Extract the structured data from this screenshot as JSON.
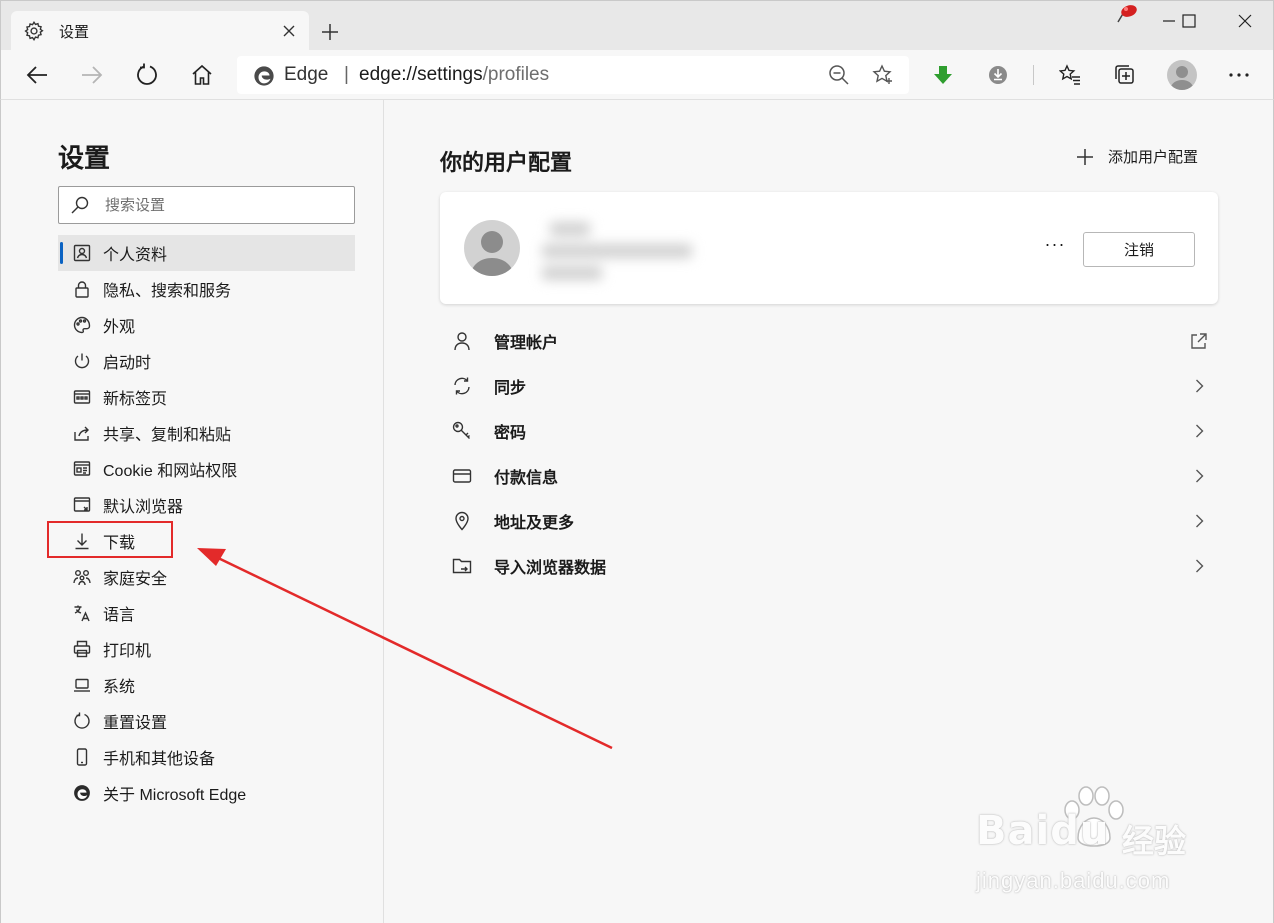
{
  "tab": {
    "title": "设置",
    "icon": "gear-icon"
  },
  "window_controls": [
    "minimize",
    "maximize",
    "close"
  ],
  "toolbar": {
    "back": "back-arrow-icon",
    "forward": "forward-arrow-icon",
    "refresh": "refresh-icon",
    "home": "home-icon",
    "site_label": "Edge",
    "separator": "|",
    "url_main": "edge://settings",
    "url_path": "/profiles"
  },
  "sidebar": {
    "title": "设置",
    "search_placeholder": "搜索设置",
    "items": [
      {
        "label": "个人资料",
        "icon": "profile-icon",
        "active": true
      },
      {
        "label": "隐私、搜索和服务",
        "icon": "lock-icon"
      },
      {
        "label": "外观",
        "icon": "palette-icon"
      },
      {
        "label": "启动时",
        "icon": "power-icon"
      },
      {
        "label": "新标签页",
        "icon": "new-tab-icon"
      },
      {
        "label": "共享、复制和粘贴",
        "icon": "share-icon"
      },
      {
        "label": "Cookie 和网站权限",
        "icon": "site-permissions-icon"
      },
      {
        "label": "默认浏览器",
        "icon": "browser-icon"
      },
      {
        "label": "下载",
        "icon": "download-icon"
      },
      {
        "label": "家庭安全",
        "icon": "family-icon"
      },
      {
        "label": "语言",
        "icon": "language-icon"
      },
      {
        "label": "打印机",
        "icon": "printer-icon"
      },
      {
        "label": "系统",
        "icon": "laptop-icon"
      },
      {
        "label": "重置设置",
        "icon": "reset-icon"
      },
      {
        "label": "手机和其他设备",
        "icon": "phone-icon"
      },
      {
        "label": "关于 Microsoft Edge",
        "icon": "edge-logo-icon"
      }
    ]
  },
  "main": {
    "title": "你的用户配置",
    "add_profile_label": "添加用户配置",
    "profile_card": {
      "more_label": "···",
      "signout_label": "注销"
    },
    "rows": [
      {
        "label": "管理帐户",
        "icon": "person-icon",
        "trail": "external-link-icon"
      },
      {
        "label": "同步",
        "icon": "sync-icon",
        "trail": "chevron-right-icon"
      },
      {
        "label": "密码",
        "icon": "key-icon",
        "trail": "chevron-right-icon"
      },
      {
        "label": "付款信息",
        "icon": "card-icon",
        "trail": "chevron-right-icon"
      },
      {
        "label": "地址及更多",
        "icon": "location-pin-icon",
        "trail": "chevron-right-icon"
      },
      {
        "label": "导入浏览器数据",
        "icon": "import-folder-icon",
        "trail": "chevron-right-icon"
      }
    ]
  },
  "watermark": {
    "brand": "Baidu",
    "brand_cn": "经验",
    "url": "jingyan.baidu.com"
  },
  "colors": {
    "accent": "#0a62c2",
    "annotation_red": "#e32a2a",
    "download_green": "#2f9e2f"
  }
}
